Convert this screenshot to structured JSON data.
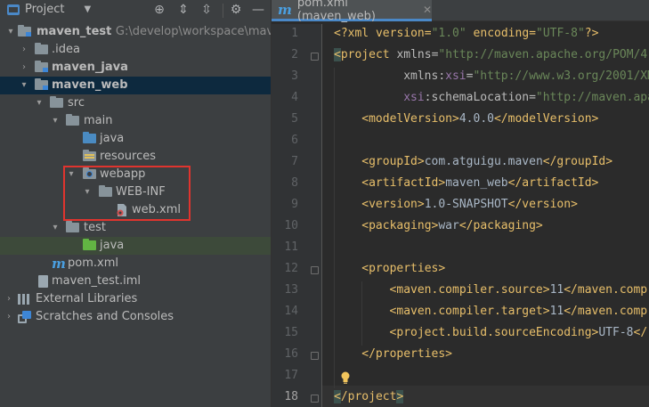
{
  "project_panel": {
    "title": "Project",
    "tree": [
      {
        "label": "maven_test",
        "path": "G:\\develop\\workspace\\maven_te",
        "bold": true
      },
      {
        "label": ".idea"
      },
      {
        "label": "maven_java",
        "bold": true
      },
      {
        "label": "maven_web",
        "bold": true
      },
      {
        "label": "src"
      },
      {
        "label": "main"
      },
      {
        "label": "java"
      },
      {
        "label": "resources"
      },
      {
        "label": "webapp"
      },
      {
        "label": "WEB-INF"
      },
      {
        "label": "web.xml"
      },
      {
        "label": "test"
      },
      {
        "label": "java"
      },
      {
        "label": "pom.xml"
      },
      {
        "label": "maven_test.iml"
      },
      {
        "label": "External Libraries"
      },
      {
        "label": "Scratches and Consoles"
      }
    ]
  },
  "editor": {
    "tab_label": "pom.xml (maven_web)",
    "current_line": 18,
    "lines": [
      [
        "<?xml version=",
        "\"1.0\"",
        " encoding=",
        "\"UTF-8\"",
        "?>"
      ],
      [
        "<project",
        " xmlns=",
        "\"http://maven.apache.org/POM/4"
      ],
      [
        "xmlns:",
        "xsi",
        "=",
        "\"http://www.w3.org/2001/XM"
      ],
      [
        "xsi",
        ":schemaLocation=",
        "\"http://maven.apa"
      ],
      [
        "<modelVersion>",
        "4.0.0",
        "</modelVersion>"
      ],
      [],
      [
        "<groupId>",
        "com.atguigu.maven",
        "</groupId>"
      ],
      [
        "<artifactId>",
        "maven_web",
        "</artifactId>"
      ],
      [
        "<version>",
        "1.0-SNAPSHOT",
        "</version>"
      ],
      [
        "<packaging>",
        "war",
        "</packaging>"
      ],
      [],
      [
        "<properties>"
      ],
      [
        "<maven.compiler.source>",
        "11",
        "</maven.comp"
      ],
      [
        "<maven.compiler.target>",
        "11",
        "</maven.comp"
      ],
      [
        "<project.build.sourceEncoding>",
        "UTF-8",
        "</"
      ],
      [
        "</properties>"
      ],
      [],
      [
        "</project",
        ">"
      ]
    ]
  }
}
